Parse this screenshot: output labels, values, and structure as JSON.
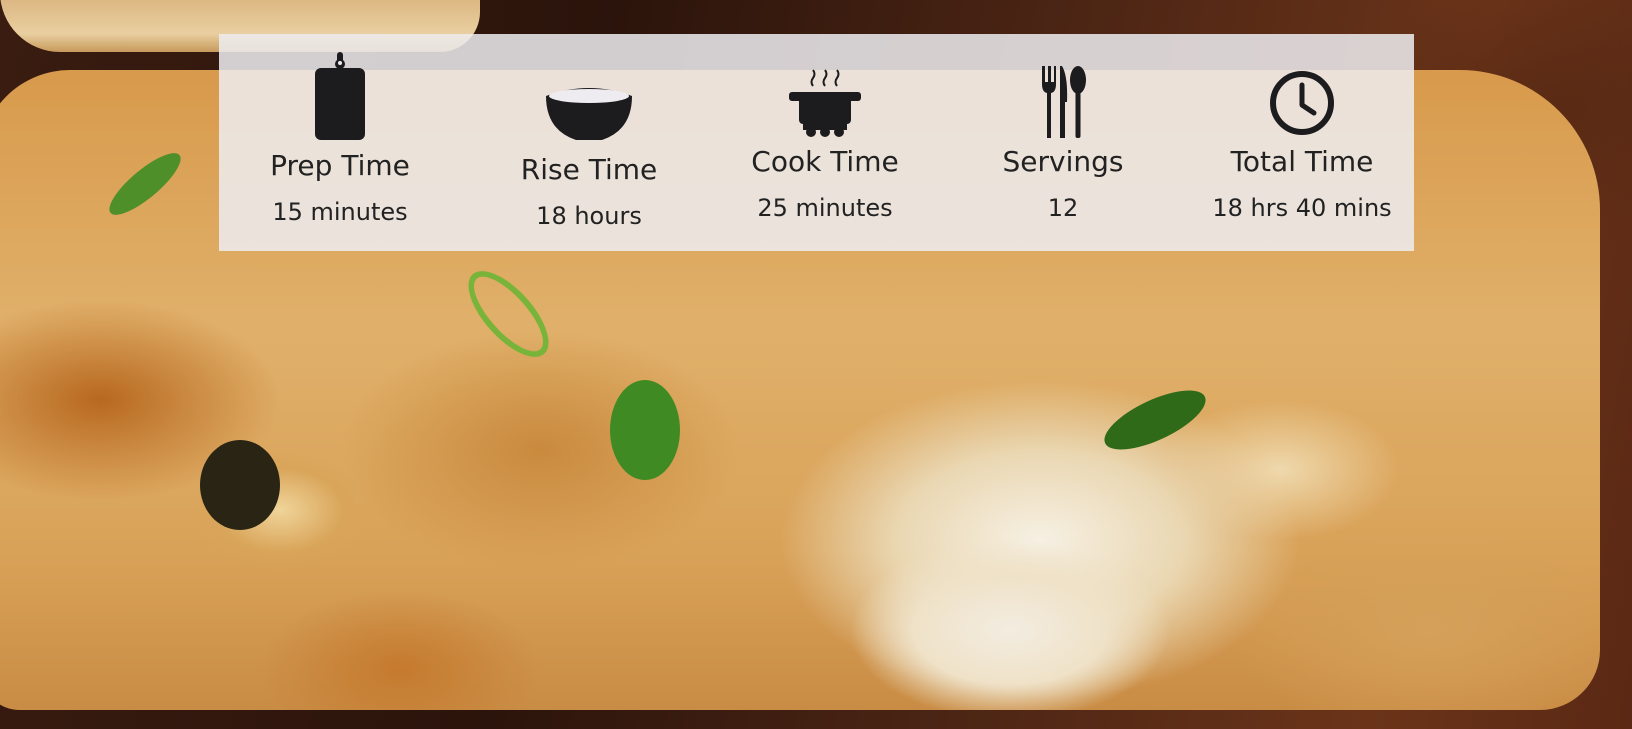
{
  "recipe_times": {
    "prep": {
      "icon": "cutting-board-icon",
      "label": "Prep Time",
      "value": "15 minutes"
    },
    "rise": {
      "icon": "bowl-icon",
      "label": "Rise Time",
      "value": "18 hours"
    },
    "cook": {
      "icon": "cooking-pot-icon",
      "label": "Cook Time",
      "value": "25 minutes"
    },
    "servings": {
      "icon": "fork-knife-spoon-icon",
      "label": "Servings",
      "value": "12"
    },
    "total": {
      "icon": "clock-icon",
      "label": "Total Time",
      "value": "18 hrs 40 mins"
    }
  },
  "colors": {
    "panel_background": "#eeecf0",
    "icon": "#1c1b1d",
    "text": "#222222"
  }
}
